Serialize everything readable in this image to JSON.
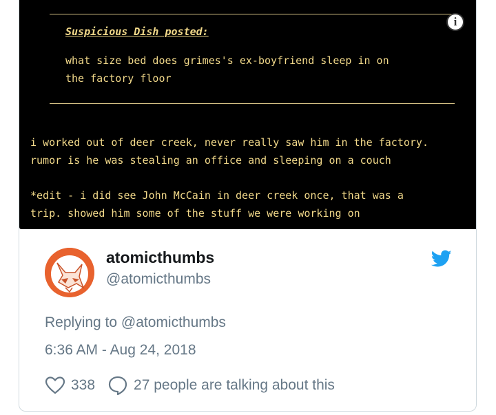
{
  "media": {
    "poster": "Suspicious Dish posted:",
    "quote_lines": [
      "what size bed does grimes's ex-boyfriend sleep in on",
      "the factory floor"
    ],
    "reply_lines": [
      "i worked out of deer creek, never really saw him in the factory.",
      "rumor is he was stealing an office and sleeping on a couch"
    ],
    "edit_lines": [
      "*edit - i did see John McCain in deer creek once, that was a",
      "trip. showed him some of the stuff we were working on"
    ],
    "info_icon": "info-icon"
  },
  "tweet": {
    "author_name": "atomicthumbs",
    "author_handle": "@atomicthumbs",
    "replying_to": "Replying to @atomicthumbs",
    "timestamp": "6:36 AM - Aug 24, 2018",
    "likes": "338",
    "talking": "27 people are talking about this",
    "brand_color": "#1da1f2",
    "avatar_color": "#e8622e"
  }
}
